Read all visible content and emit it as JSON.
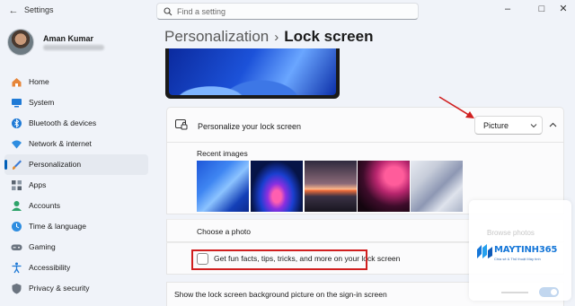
{
  "window": {
    "title": "Settings"
  },
  "search": {
    "placeholder": "Find a setting"
  },
  "user": {
    "name": "Aman Kumar"
  },
  "sidebar": {
    "items": [
      {
        "label": "Home",
        "icon": "home-icon",
        "color": "#e6863a"
      },
      {
        "label": "System",
        "icon": "system-icon",
        "color": "#1f7ad6"
      },
      {
        "label": "Bluetooth & devices",
        "icon": "bluetooth-icon",
        "color": "#1f7ad6"
      },
      {
        "label": "Network & internet",
        "icon": "wifi-icon",
        "color": "#2e8de0"
      },
      {
        "label": "Personalization",
        "icon": "brush-icon",
        "color": "#e08a2e",
        "active": true
      },
      {
        "label": "Apps",
        "icon": "apps-icon",
        "color": "#5a6470"
      },
      {
        "label": "Accounts",
        "icon": "accounts-icon",
        "color": "#2ea36a"
      },
      {
        "label": "Time & language",
        "icon": "globe-clock-icon",
        "color": "#2e8de0"
      },
      {
        "label": "Gaming",
        "icon": "gamepad-icon",
        "color": "#6b7480"
      },
      {
        "label": "Accessibility",
        "icon": "accessibility-icon",
        "color": "#1f7ad6"
      },
      {
        "label": "Privacy & security",
        "icon": "shield-icon",
        "color": "#6b7480"
      }
    ]
  },
  "breadcrumb": {
    "parent": "Personalization",
    "separator": "›",
    "current": "Lock screen"
  },
  "lock_screen": {
    "personalize_label": "Personalize your lock screen",
    "selected_option": "Picture",
    "recent_images_label": "Recent images",
    "choose_photo_label": "Choose a photo",
    "fun_facts_label": "Get fun facts, tips, tricks, and more on your lock screen",
    "fun_facts_checked": false,
    "signin_label": "Show the lock screen background picture on the sign-in screen"
  },
  "watermark": {
    "faded_text": "Browse photos",
    "brand": "MAYTINH365",
    "tagline": "Chia sẻ & Thủ thuật Máy tính"
  },
  "colors": {
    "accent": "#005fb8",
    "highlight": "#d01f1f"
  }
}
